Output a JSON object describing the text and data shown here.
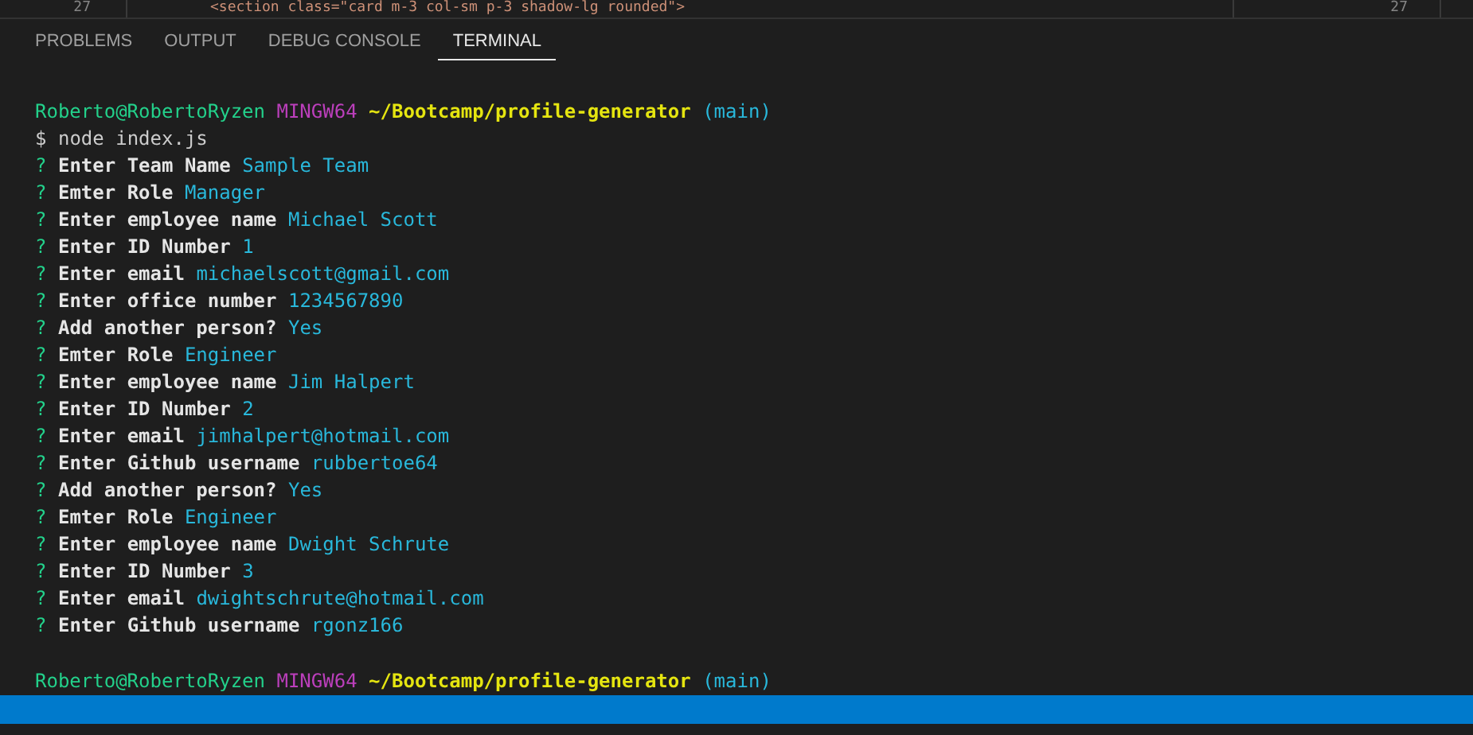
{
  "editor": {
    "line_number": "27",
    "code": "<section class=\"card m-3 col-sm p-3 shadow-lg rounded\">",
    "minimap_line_number": "27"
  },
  "panel": {
    "tabs": [
      {
        "label": "PROBLEMS",
        "selected": false
      },
      {
        "label": "OUTPUT",
        "selected": false
      },
      {
        "label": "DEBUG CONSOLE",
        "selected": false
      },
      {
        "label": "TERMINAL",
        "selected": true
      }
    ]
  },
  "terminal": {
    "lines": [
      {
        "kind": "prompt",
        "user": "Roberto@RobertoRyzen",
        "system": "MINGW64",
        "path": "~/Bootcamp/profile-generator",
        "branch": "(main)"
      },
      {
        "kind": "command",
        "symbol": "$",
        "text": "node index.js"
      },
      {
        "kind": "question",
        "mark": "?",
        "label": "Enter Team Name",
        "answer": "Sample Team"
      },
      {
        "kind": "question",
        "mark": "?",
        "label": "Emter Role",
        "answer": "Manager"
      },
      {
        "kind": "question",
        "mark": "?",
        "label": "Enter employee name",
        "answer": "Michael Scott"
      },
      {
        "kind": "question",
        "mark": "?",
        "label": "Enter ID Number",
        "answer": "1"
      },
      {
        "kind": "question",
        "mark": "?",
        "label": "Enter email",
        "answer": "michaelscott@gmail.com"
      },
      {
        "kind": "question",
        "mark": "?",
        "label": "Enter office number",
        "answer": "1234567890"
      },
      {
        "kind": "question",
        "mark": "?",
        "label": "Add another person?",
        "answer": "Yes"
      },
      {
        "kind": "question",
        "mark": "?",
        "label": "Emter Role",
        "answer": "Engineer"
      },
      {
        "kind": "question",
        "mark": "?",
        "label": "Enter employee name",
        "answer": "Jim Halpert"
      },
      {
        "kind": "question",
        "mark": "?",
        "label": "Enter ID Number",
        "answer": "2"
      },
      {
        "kind": "question",
        "mark": "?",
        "label": "Enter email",
        "answer": "jimhalpert@hotmail.com"
      },
      {
        "kind": "question",
        "mark": "?",
        "label": "Enter Github username",
        "answer": "rubbertoe64"
      },
      {
        "kind": "question",
        "mark": "?",
        "label": "Add another person?",
        "answer": "Yes"
      },
      {
        "kind": "question",
        "mark": "?",
        "label": "Emter Role",
        "answer": "Engineer"
      },
      {
        "kind": "question",
        "mark": "?",
        "label": "Enter employee name",
        "answer": "Dwight Schrute"
      },
      {
        "kind": "question",
        "mark": "?",
        "label": "Enter ID Number",
        "answer": "3"
      },
      {
        "kind": "question",
        "mark": "?",
        "label": "Enter email",
        "answer": "dwightschrute@hotmail.com"
      },
      {
        "kind": "question",
        "mark": "?",
        "label": "Enter Github username",
        "answer": "rgonz166"
      },
      {
        "kind": "blank"
      },
      {
        "kind": "prompt",
        "user": "Roberto@RobertoRyzen",
        "system": "MINGW64",
        "path": "~/Bootcamp/profile-generator",
        "branch": "(main)"
      }
    ]
  }
}
